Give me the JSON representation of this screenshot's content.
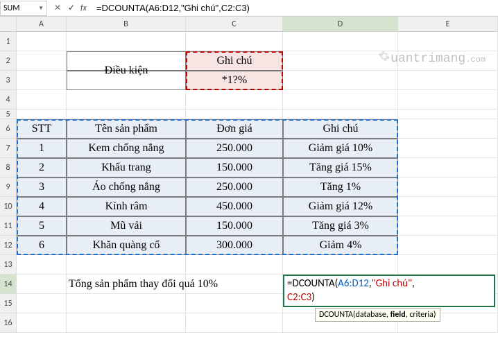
{
  "formula_bar": {
    "name_box": "SUM",
    "formula": "=DCOUNTA(A6:D12,\"Ghi chú\",C2:C3)"
  },
  "col_headers": [
    "A",
    "B",
    "C",
    "D",
    "E"
  ],
  "row_headers": [
    "1",
    "2",
    "3",
    "4",
    "5",
    "6",
    "7",
    "8",
    "9",
    "10",
    "11",
    "12",
    "13",
    "14",
    "15",
    "16"
  ],
  "criteria": {
    "label": "Điều kiện",
    "field": "Ghi chú",
    "pattern": "*1?%"
  },
  "table": {
    "headers": {
      "stt": "STT",
      "name": "Tên sản phẩm",
      "price": "Đơn giá",
      "note": "Ghi chú"
    },
    "rows": [
      {
        "stt": "1",
        "name": "Kem chống nắng",
        "price": "250.000",
        "note": "Giảm giá 10%"
      },
      {
        "stt": "2",
        "name": "Khẩu trang",
        "price": "150.000",
        "note": "Tăng giá 15%"
      },
      {
        "stt": "3",
        "name": "Áo chống nắng",
        "price": "250.000",
        "note": "Tăng 1%"
      },
      {
        "stt": "4",
        "name": "Kính râm",
        "price": "450.000",
        "note": "Giảm giá 12%"
      },
      {
        "stt": "5",
        "name": "Mũ vải",
        "price": "150.000",
        "note": "Tăng giá 3%"
      },
      {
        "stt": "6",
        "name": "Khăn quàng cổ",
        "price": "300.000",
        "note": "Giảm 4%"
      }
    ]
  },
  "summary_label": "Tổng sản phẩm thay đổi quá 10%",
  "formula_display": {
    "p1": "=DCOUNTA(",
    "p2": "A6:D12",
    "p3": ",",
    "p4": "\"Ghi chú\"",
    "p5": ",",
    "p6": "C2:C3",
    "p7": ")"
  },
  "tooltip": {
    "fn": "DCOUNTA",
    "a1": "database",
    "a2": "field",
    "a3": "criteria"
  },
  "watermark": "uantrimang"
}
